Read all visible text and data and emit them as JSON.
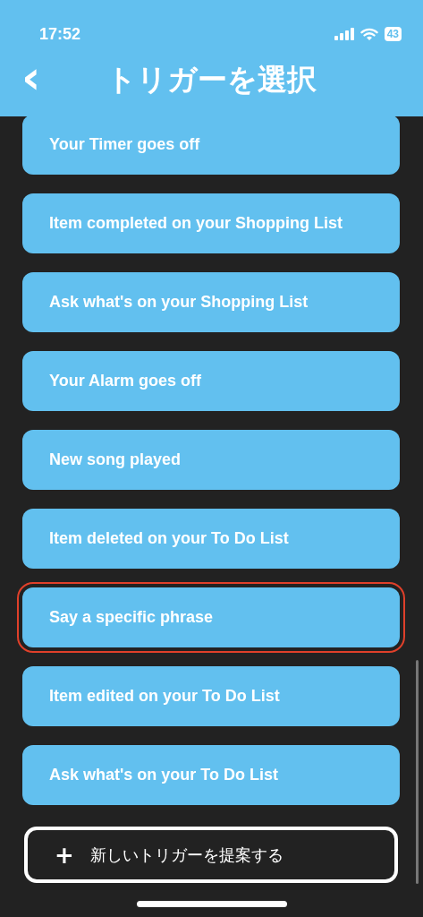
{
  "status_bar": {
    "time": "17:52",
    "battery": "43"
  },
  "header": {
    "back": "‹",
    "title": "トリガーを選択"
  },
  "triggers": [
    {
      "label": "Your Timer goes off",
      "highlighted": false
    },
    {
      "label": "Item completed on your Shopping List",
      "highlighted": false
    },
    {
      "label": "Ask what's on your Shopping List",
      "highlighted": false
    },
    {
      "label": "Your Alarm goes off",
      "highlighted": false
    },
    {
      "label": "New song played",
      "highlighted": false
    },
    {
      "label": "Item deleted on your To Do List",
      "highlighted": false
    },
    {
      "label": "Say a specific phrase",
      "highlighted": true
    },
    {
      "label": "Item edited on your To Do List",
      "highlighted": false
    },
    {
      "label": "Ask what's on your To Do List",
      "highlighted": false
    }
  ],
  "suggest_button": {
    "icon": "+",
    "label": "新しいトリガーを提案する"
  }
}
